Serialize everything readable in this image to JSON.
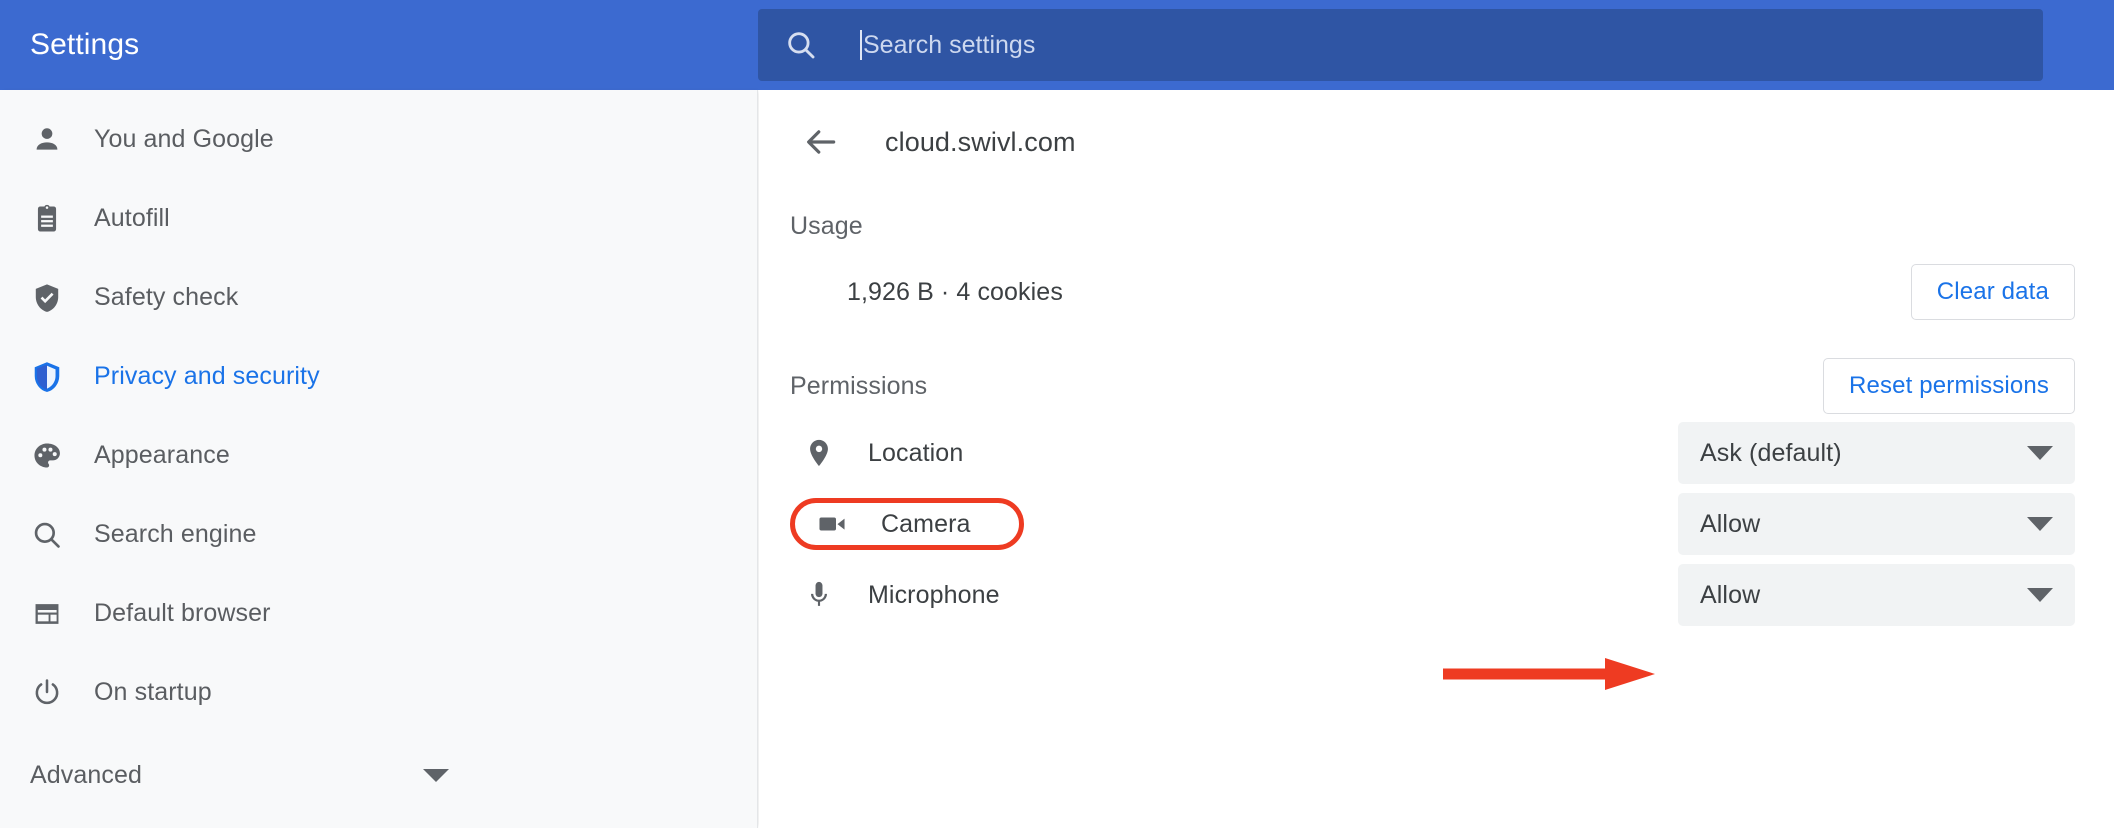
{
  "header": {
    "brand_title": "Settings",
    "search": {
      "icon": "search-icon",
      "placeholder": "Search settings",
      "value": ""
    }
  },
  "sidebar": {
    "items": [
      {
        "label": "You and Google",
        "icon": "person-icon",
        "active": false
      },
      {
        "label": "Autofill",
        "icon": "clipboard-icon",
        "active": false
      },
      {
        "label": "Safety check",
        "icon": "shield-check-icon",
        "active": false
      },
      {
        "label": "Privacy and security",
        "icon": "shield-privacy-icon",
        "active": true
      },
      {
        "label": "Appearance",
        "icon": "palette-icon",
        "active": false
      },
      {
        "label": "Search engine",
        "icon": "search-icon",
        "active": false
      },
      {
        "label": "Default browser",
        "icon": "browser-window-icon",
        "active": false
      },
      {
        "label": "On startup",
        "icon": "power-icon",
        "active": false
      }
    ],
    "advanced": {
      "label": "Advanced",
      "icon": "chevron-down-icon"
    }
  },
  "main": {
    "back_icon": "back-arrow-icon",
    "page_title": "cloud.swivl.com",
    "usage": {
      "section_label": "Usage",
      "detail": "1,926 B · 4 cookies",
      "clear_button": "Clear data"
    },
    "permissions": {
      "section_label": "Permissions",
      "reset_button": "Reset permissions",
      "rows": [
        {
          "label": "Location",
          "icon": "location-pin-icon",
          "value": "Ask (default)",
          "highlighted": false
        },
        {
          "label": "Camera",
          "icon": "video-camera-icon",
          "value": "Allow",
          "highlighted": true
        },
        {
          "label": "Microphone",
          "icon": "microphone-icon",
          "value": "Allow",
          "highlighted": false
        }
      ]
    }
  },
  "annotations": {
    "highlight_color": "#ee3b22",
    "arrow": {
      "icon": "right-arrow-annotation",
      "points_to": "Camera permission dropdown"
    }
  },
  "colors": {
    "header_blue": "#3c6ad0",
    "search_blue": "#2f55a4",
    "accent_blue": "#1a73e8",
    "sidebar_bg": "#f8f9fa",
    "select_bg": "#f1f3f4",
    "annotation_red": "#ee3b22"
  }
}
